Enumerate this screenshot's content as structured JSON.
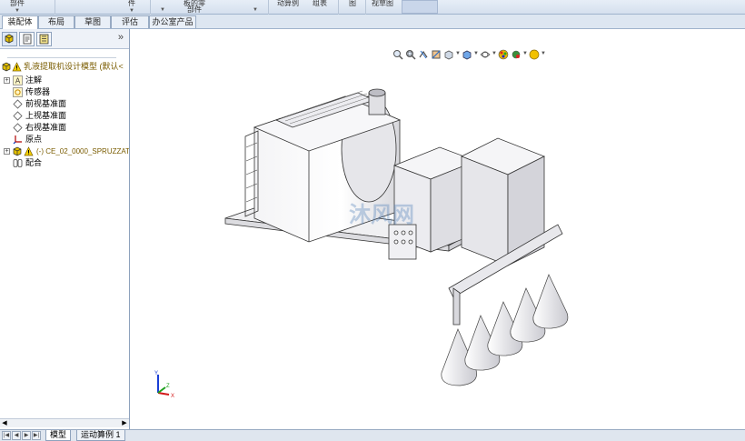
{
  "ribbon": {
    "items": [
      {
        "label": "部件",
        "has_arrow": true
      },
      {
        "label": "件",
        "has_arrow": true
      },
      {
        "label": "板的零\n部件",
        "has_arrow": true
      },
      {
        "label": "动算例",
        "has_arrow": false
      },
      {
        "label": "组表",
        "has_arrow": false
      },
      {
        "label": "图",
        "has_arrow": false
      },
      {
        "label": "视草图",
        "has_arrow": false
      }
    ]
  },
  "tabs": [
    {
      "label": "装配体",
      "active": true
    },
    {
      "label": "布局",
      "active": false
    },
    {
      "label": "草图",
      "active": false
    },
    {
      "label": "评估",
      "active": false
    },
    {
      "label": "办公室产品",
      "active": false
    }
  ],
  "feature_manager": {
    "more_glyph": "»",
    "tree": [
      {
        "label": "乳液提取机设计模型 (默认<",
        "icon": "assembly-warning-icon",
        "expander": "",
        "level": 0,
        "color": "#7a5c00"
      },
      {
        "label": "注解",
        "icon": "annotation-icon",
        "expander": "+",
        "level": 1,
        "color": "#000000"
      },
      {
        "label": "传感器",
        "icon": "sensor-icon",
        "expander": "",
        "level": 1,
        "color": "#000000"
      },
      {
        "label": "前视基准面",
        "icon": "plane-icon",
        "expander": "",
        "level": 1,
        "color": "#000000"
      },
      {
        "label": "上视基准面",
        "icon": "plane-icon",
        "expander": "",
        "level": 1,
        "color": "#000000"
      },
      {
        "label": "右视基准面",
        "icon": "plane-icon",
        "expander": "",
        "level": 1,
        "color": "#000000"
      },
      {
        "label": "原点",
        "icon": "origin-icon",
        "expander": "",
        "level": 1,
        "color": "#000000"
      },
      {
        "label": "(-) CE_02_0000_SPRUZZAT",
        "icon": "part-warning-icon",
        "expander": "+",
        "level": 1,
        "color": "#7a5c00"
      },
      {
        "label": "配合",
        "icon": "mates-icon",
        "expander": "",
        "level": 1,
        "color": "#000000"
      }
    ]
  },
  "bottom_tabs": [
    {
      "label": "模型",
      "active": true
    },
    {
      "label": "运动算例 1",
      "active": false
    }
  ],
  "triad": {
    "x": "X",
    "y": "Y",
    "z": "Z"
  },
  "watermark": {
    "text": "沐风网"
  },
  "colors": {
    "ribbon_bg": "#dde6f1",
    "accent_warning": "#e8c000",
    "tree_warning_text": "#7a5c00"
  }
}
